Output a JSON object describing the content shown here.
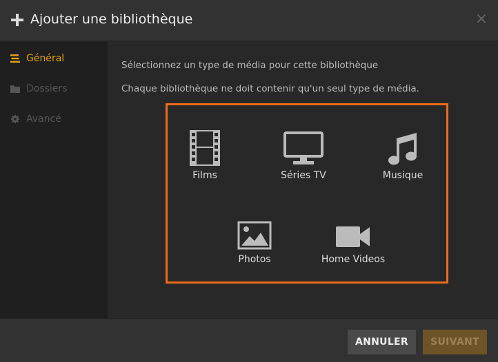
{
  "header": {
    "title": "Ajouter une bibliothèque",
    "plus_icon": "plus-icon",
    "close_label": "×"
  },
  "sidebar": {
    "items": [
      {
        "label": "Général",
        "icon": "list-icon",
        "active": true
      },
      {
        "label": "Dossiers",
        "icon": "folder-icon",
        "active": false
      },
      {
        "label": "Avancé",
        "icon": "gear-icon",
        "active": false
      }
    ]
  },
  "content": {
    "line1": "Sélectionnez un type de média pour cette bibliothèque",
    "line2": "Chaque bibliothèque ne doit contenir qu'un seul type de média.",
    "media_types": [
      {
        "label": "Films",
        "icon": "film-icon"
      },
      {
        "label": "Séries TV",
        "icon": "tv-icon"
      },
      {
        "label": "Musique",
        "icon": "music-icon"
      },
      {
        "label": "Photos",
        "icon": "photo-icon"
      },
      {
        "label": "Home Videos",
        "icon": "video-camera-icon"
      }
    ]
  },
  "footer": {
    "cancel_label": "ANNULER",
    "next_label": "SUIVANT"
  },
  "colors": {
    "accent": "#e5a00d",
    "highlight_border": "#ef6b19",
    "background": "#282828",
    "sidebar_bg": "#1f1f1f"
  }
}
